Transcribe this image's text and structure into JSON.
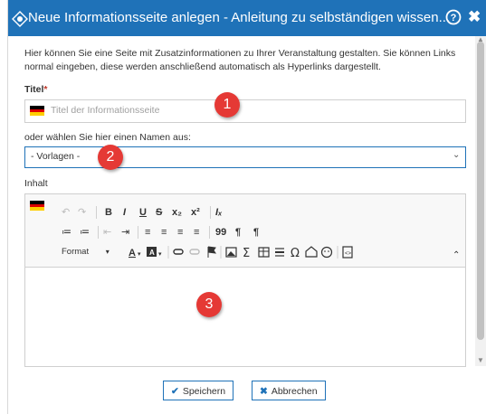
{
  "dialog": {
    "title": "Neue Informationsseite anlegen - Anleitung zu selbständigen wissen...",
    "help_icon": "question-circle-icon",
    "close_label": "✖"
  },
  "intro_text": "Hier können Sie eine Seite mit Zusatzinformationen zu Ihrer Veranstaltung gestalten. Sie können Links normal eingeben, diese werden anschließend automatisch als Hyperlinks dargestellt.",
  "title_field": {
    "label": "Titel",
    "required_mark": "*",
    "placeholder": "Titel der Informationsseite",
    "value": "",
    "language_flag": "de-flag-icon"
  },
  "template_select": {
    "label": "oder wählen Sie hier einen Namen aus:",
    "selected": "- Vorlagen -"
  },
  "content_editor": {
    "label": "Inhalt",
    "language_flag": "de-flag-icon",
    "format_label": "Format",
    "toolbar_row1": [
      "↶",
      "↷",
      "B",
      "I",
      "U",
      "S",
      "x₂",
      "x²",
      "Iₓ"
    ],
    "toolbar_row2": [
      "≔",
      "≔",
      "⇤",
      "⇥",
      "≡",
      "≡",
      "≡",
      "≡",
      "99",
      "¶",
      "¶"
    ],
    "value": ""
  },
  "markers": [
    "1",
    "2",
    "3"
  ],
  "buttons": {
    "save": "Speichern",
    "cancel": "Abbrechen"
  },
  "colors": {
    "titlebar": "#1f72b8",
    "marker": "#e53935",
    "required": "#c0392b"
  }
}
